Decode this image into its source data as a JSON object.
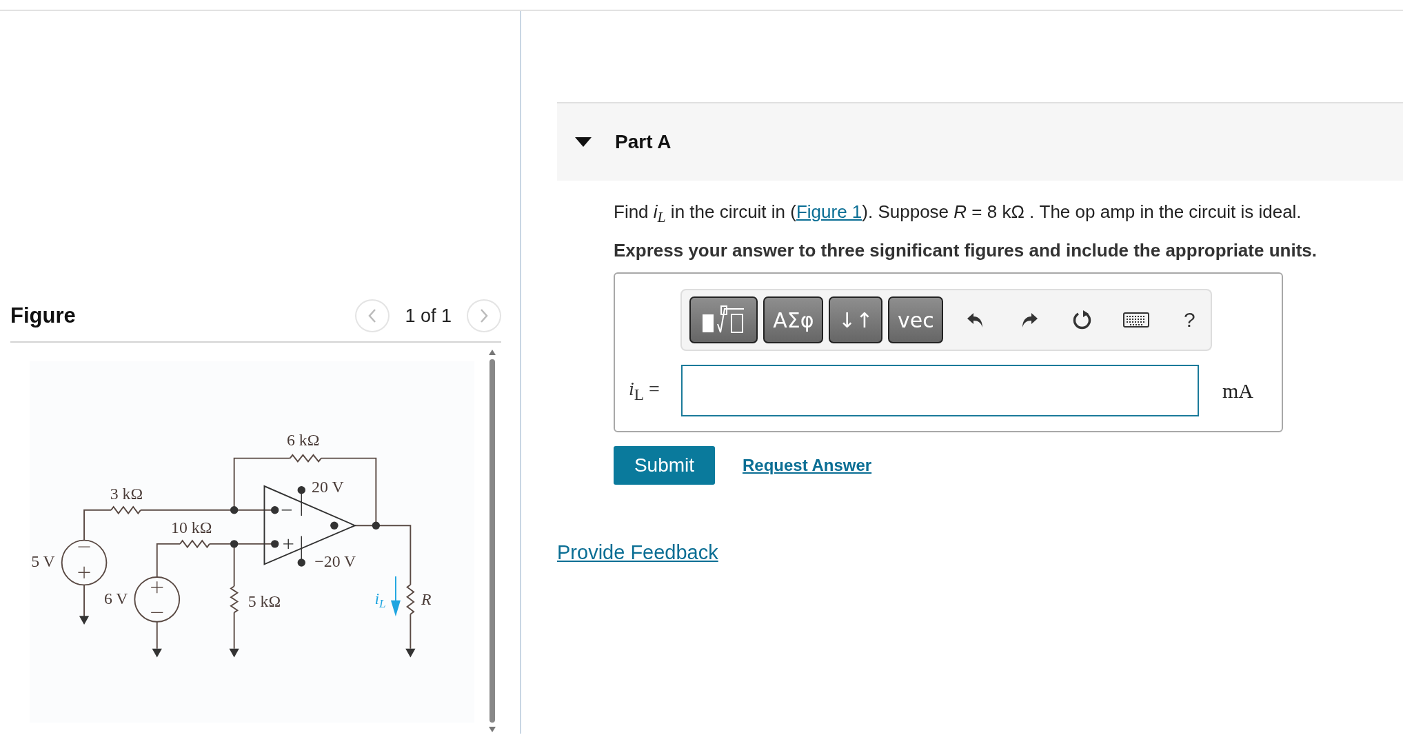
{
  "figure_panel": {
    "title": "Figure",
    "pager": "1 of 1",
    "circuit_labels": [
      {
        "text": "6 kΩ",
        "kind": "value"
      },
      {
        "text": "3 kΩ",
        "kind": "value"
      },
      {
        "text": "10 kΩ",
        "kind": "value"
      },
      {
        "text": "20 V",
        "kind": "value"
      },
      {
        "text": "−20 V",
        "kind": "value"
      },
      {
        "text": "5 V",
        "kind": "value"
      },
      {
        "text": "6 V",
        "kind": "value"
      },
      {
        "text": "5 kΩ",
        "kind": "value"
      },
      {
        "text": "i",
        "sub": "L",
        "kind": "current"
      },
      {
        "text": "R",
        "kind": "symbol"
      }
    ]
  },
  "part": {
    "title": "Part A",
    "expanded": true,
    "question_before": "Find *i*$_{L}$ in the circuit in (",
    "figure_link": "Figure 1",
    "question_after": "). Suppose *R* = 8  kΩ . The op amp in the circuit is ideal.",
    "instruction": "Express your answer to three significant figures and include the appropriate units.",
    "toolbar": [
      {
        "kind": "template"
      },
      {
        "kind": "text",
        "label": "ΑΣφ"
      },
      {
        "kind": "text",
        "label": "↓↑"
      },
      {
        "kind": "text",
        "label": "vec"
      },
      {
        "kind": "undo"
      },
      {
        "kind": "redo"
      },
      {
        "kind": "reset"
      },
      {
        "kind": "keyboard"
      },
      {
        "kind": "help",
        "label": "?"
      }
    ],
    "answer_label": "*i*$_{L}$ =",
    "unit": "mA",
    "submit": "Submit",
    "request_answer": "Request Answer"
  },
  "feedback_link": "Provide Feedback"
}
